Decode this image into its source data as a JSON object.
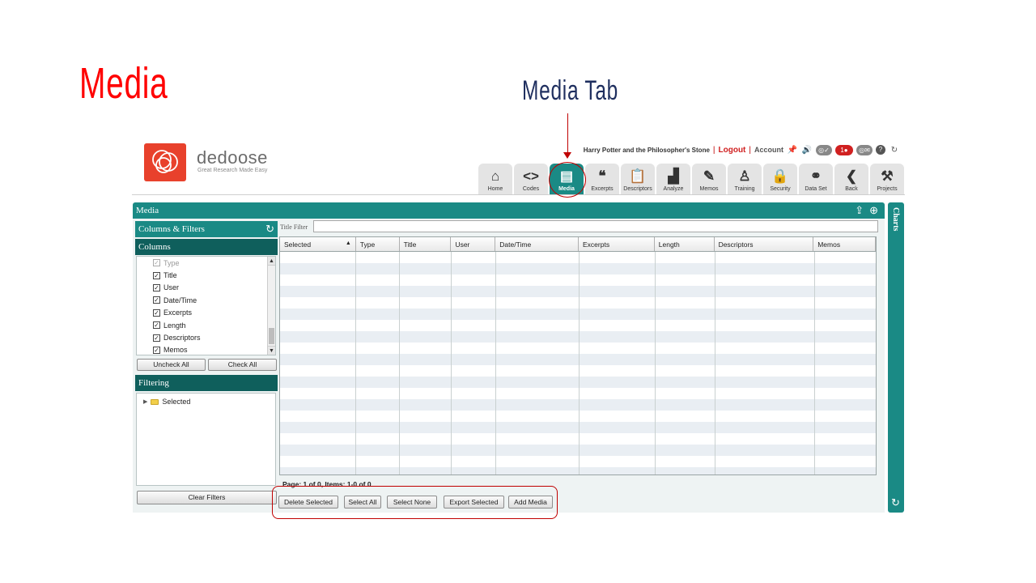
{
  "slide": {
    "title": "Media",
    "callout": "Media Tab"
  },
  "colors": {
    "teal": "#1a8a85",
    "teal_dark": "#0f5f5c",
    "annotation_red": "#c00000",
    "logo_orange": "#e8412c"
  },
  "app": {
    "logo_text": "dedoose",
    "logo_tagline": "Great Research Made Easy",
    "project_name": "Harry Potter and the Philosopher's Stone",
    "logout": "Logout",
    "account": "Account",
    "notifications_count": "1",
    "top_icons": [
      "pin-icon",
      "volume-icon",
      "checklist-icon",
      "notifications-icon",
      "mail-icon",
      "help-icon",
      "refresh-icon"
    ]
  },
  "nav": [
    {
      "label": "Home",
      "icon": "⌂",
      "icon_name": "home-icon",
      "active": false
    },
    {
      "label": "Codes",
      "icon": "<>",
      "icon_name": "codes-icon",
      "active": false
    },
    {
      "label": "Media",
      "icon": "▤",
      "icon_name": "media-icon",
      "active": true
    },
    {
      "label": "Excerpts",
      "icon": "❝",
      "icon_name": "quote-icon",
      "active": false
    },
    {
      "label": "Descriptors",
      "icon": "📋",
      "icon_name": "clipboard-icon",
      "active": false
    },
    {
      "label": "Analyze",
      "icon": "▟",
      "icon_name": "bar-chart-icon",
      "active": false
    },
    {
      "label": "Memos",
      "icon": "✎",
      "icon_name": "memo-icon",
      "active": false
    },
    {
      "label": "Training",
      "icon": "♙",
      "icon_name": "training-icon",
      "active": false
    },
    {
      "label": "Security",
      "icon": "🔒",
      "icon_name": "lock-icon",
      "active": false
    },
    {
      "label": "Data Set",
      "icon": "⚭",
      "icon_name": "binoculars-icon",
      "active": false
    },
    {
      "label": "Back",
      "icon": "❮",
      "icon_name": "back-icon",
      "active": false
    },
    {
      "label": "Projects",
      "icon": "⚒",
      "icon_name": "projects-icon",
      "active": false
    }
  ],
  "panel": {
    "title": "Media",
    "charts_label": "Charts"
  },
  "sidebar": {
    "columns_filters_title": "Columns & Filters",
    "columns_title": "Columns",
    "columns": [
      {
        "label": "Type",
        "checked": true,
        "disabled": true
      },
      {
        "label": "Title",
        "checked": true,
        "disabled": false
      },
      {
        "label": "User",
        "checked": true,
        "disabled": false
      },
      {
        "label": "Date/Time",
        "checked": true,
        "disabled": false
      },
      {
        "label": "Excerpts",
        "checked": true,
        "disabled": false
      },
      {
        "label": "Length",
        "checked": true,
        "disabled": false
      },
      {
        "label": "Descriptors",
        "checked": true,
        "disabled": false
      },
      {
        "label": "Memos",
        "checked": true,
        "disabled": false
      }
    ],
    "uncheck_all": "Uncheck All",
    "check_all": "Check All",
    "filtering_title": "Filtering",
    "filter_tree_item": "Selected",
    "clear_filters": "Clear Filters"
  },
  "grid": {
    "title_filter_label": "Title Filter",
    "title_filter_value": "",
    "columns": [
      "Selected",
      "Type",
      "Title",
      "User",
      "Date/Time",
      "Excerpts",
      "Length",
      "Descriptors",
      "Memos"
    ],
    "rows": []
  },
  "pager": {
    "text": "Page: 1 of 0, Items: 1-0 of 0"
  },
  "actions": {
    "delete_selected": "Delete Selected",
    "select_all": "Select All",
    "select_none": "Select None",
    "export_selected": "Export Selected",
    "add_media": "Add Media"
  }
}
